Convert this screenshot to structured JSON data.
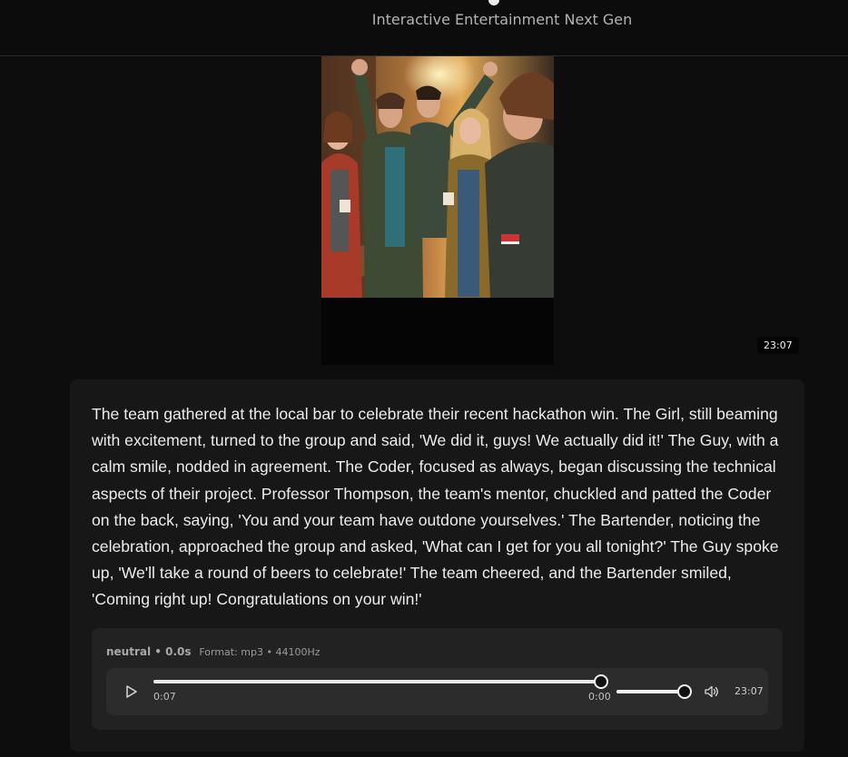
{
  "header": {
    "subtitle": "Interactive Entertainment Next Gen"
  },
  "media": {
    "timestamp": "23:07",
    "image_alt": "Group of friends celebrating at a bar"
  },
  "story": {
    "text": "The team gathered at the local bar to celebrate their recent hackathon win. The Girl, still beaming with excitement, turned to the group and said, 'We did it, guys! We actually did it!' The Guy, with a calm smile, nodded in agreement. The Coder, focused as always, began discussing the technical aspects of their project. Professor Thompson, the team's mentor, chuckled and patted the Coder on the back, saying, 'You and your team have outdone yourselves.' The Bartender, noticing the celebration, approached the group and asked, 'What can I get for you all tonight?' The Guy spoke up, 'We'll take a round of beers to celebrate!' The team cheered, and the Bartender smiled, 'Coming right up! Congratulations on your win!'"
  },
  "audio": {
    "voice_label": "neutral • 0.0s",
    "format_label": "Format: mp3 • 44100Hz",
    "current_time": "0:07",
    "remaining_time": "0:00",
    "duration": "23:07",
    "progress_fraction": 1.0,
    "volume_fraction": 1.0,
    "icons": {
      "play": "play-icon",
      "volume": "volume-icon"
    }
  },
  "colors": {
    "background": "#0d0d0d",
    "card": "#171717",
    "audio_panel": "#222222",
    "player": "#2c2c2c",
    "text": "#ececec",
    "muted": "#9a9a9a"
  }
}
